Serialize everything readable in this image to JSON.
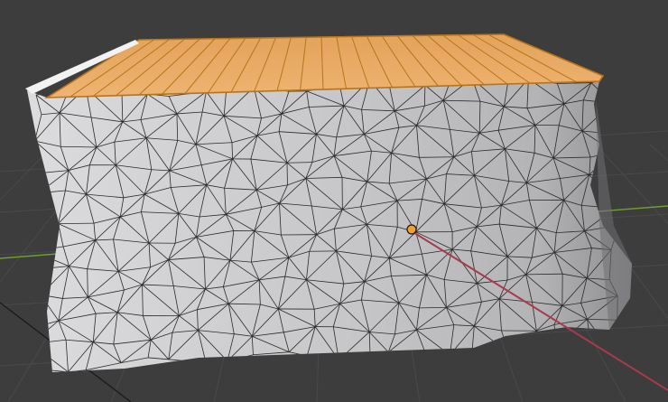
{
  "viewport": {
    "background": "#3d3d3d",
    "grid_color": "#4a4a4a",
    "x_axis_color": "#a8394f",
    "y_axis_color": "#6f9f2e",
    "origin_color": "#f0a030"
  },
  "mesh": {
    "surface_color": "#c4c4c6",
    "wire_color": "#2a2a2a",
    "selected_face_color": "#e8a65a",
    "selected_edge_color": "#b8741c",
    "bevel_highlight": "#f2f2f2",
    "top_face_stripe_count": 24
  }
}
